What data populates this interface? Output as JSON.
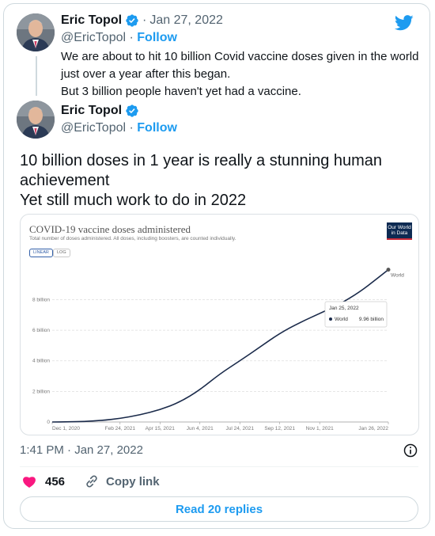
{
  "quoted_tweet": {
    "author_name": "Eric Topol",
    "date": "Jan 27, 2022",
    "handle": "@EricTopol",
    "follow_label": "Follow",
    "text_line_1": "We are about to hit 10 billion Covid vaccine doses given in the world",
    "text_line_2": "just over a year after this began.",
    "text_line_3": "But 3 billion people haven't yet had a vaccine."
  },
  "main_tweet": {
    "author_name": "Eric Topol",
    "handle": "@EricTopol",
    "follow_label": "Follow",
    "text_line_1": "10 billion doses in 1 year is really a stunning human",
    "text_line_2": "achievement",
    "text_line_3": "Yet still much work to do in 2022",
    "timestamp": "1:41 PM · Jan 27, 2022",
    "like_count": "456",
    "copy_link_label": "Copy link",
    "read_replies_label": "Read 20 replies"
  },
  "colors": {
    "accent": "#1d9bf0",
    "like": "#f91880",
    "line": "#1a2a4a",
    "owid_navy": "#0d2a52",
    "owid_red": "#c92b3a"
  },
  "icons": [
    "twitter-bird-icon",
    "verified-badge-icon",
    "info-icon",
    "heart-icon",
    "link-icon"
  ],
  "chart": {
    "logo_line_1": "Our World",
    "logo_line_2": "in Data",
    "linear_label": "LINEAR",
    "log_label": "LOG",
    "tooltip_date": "Jan 25, 2022",
    "tooltip_series": "World",
    "tooltip_value": "9.96 billion"
  },
  "chart_data": {
    "type": "line",
    "title": "COVID-19 vaccine doses administered",
    "subtitle": "Total number of doses administered. All doses, including boosters, are counted individually.",
    "xlabel": "",
    "ylabel": "",
    "grid": true,
    "legend": "end-of-line label",
    "x_tick_labels": [
      "Dec 1, 2020",
      "Feb 24, 2021",
      "Apr 15, 2021",
      "Jun 4, 2021",
      "Jul 24, 2021",
      "Sep 12, 2021",
      "Nov 1, 2021",
      "Jan 26, 2022"
    ],
    "x_tick_dates": [
      "2020-12-01",
      "2021-02-24",
      "2021-04-15",
      "2021-06-04",
      "2021-07-24",
      "2021-09-12",
      "2021-11-01",
      "2022-01-26"
    ],
    "y_tick_values": [
      0,
      2,
      4,
      6,
      8
    ],
    "y_tick_labels": [
      "0",
      "2 billion",
      "4 billion",
      "6 billion",
      "8 billion"
    ],
    "xlim": [
      "2020-12-01",
      "2022-01-26"
    ],
    "ylim": [
      0,
      10.2
    ],
    "series": [
      {
        "name": "World",
        "x": [
          "2020-12-01",
          "2020-12-20",
          "2021-01-10",
          "2021-02-01",
          "2021-02-24",
          "2021-03-20",
          "2021-04-15",
          "2021-05-10",
          "2021-06-04",
          "2021-06-29",
          "2021-07-24",
          "2021-08-18",
          "2021-09-12",
          "2021-10-07",
          "2021-11-01",
          "2021-11-26",
          "2021-12-21",
          "2022-01-10",
          "2022-01-26"
        ],
        "values": [
          0,
          0.01,
          0.03,
          0.1,
          0.23,
          0.45,
          0.8,
          1.3,
          2.1,
          3.15,
          4.0,
          4.9,
          5.8,
          6.5,
          7.1,
          7.7,
          8.5,
          9.3,
          9.96
        ]
      }
    ]
  }
}
